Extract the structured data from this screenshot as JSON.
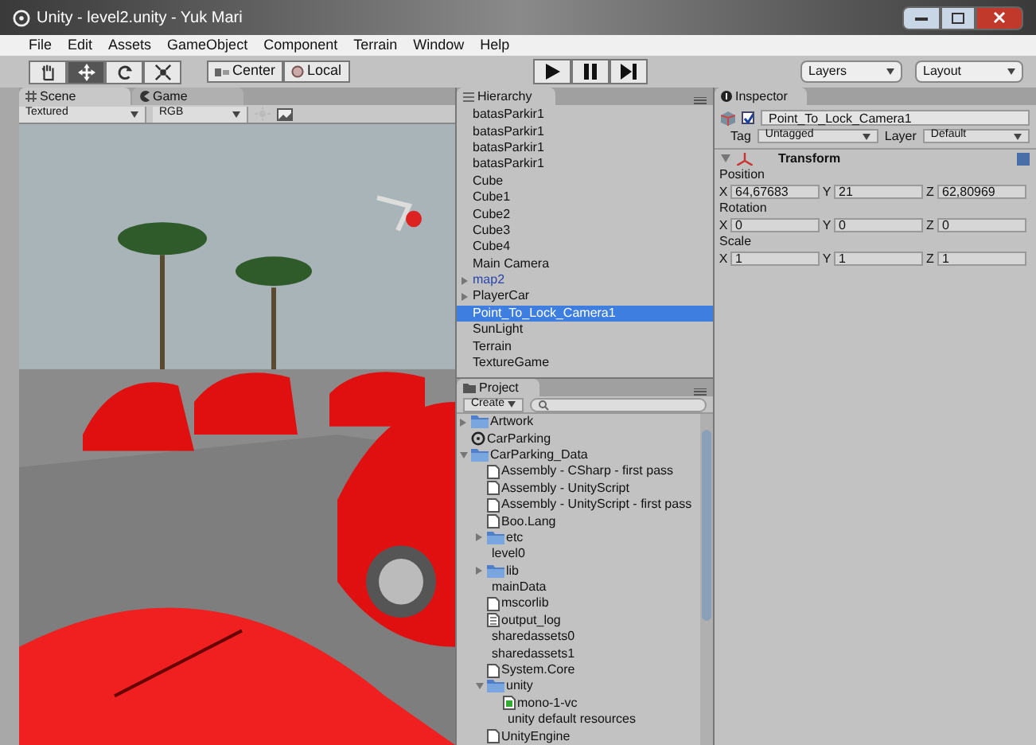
{
  "window": {
    "title": "Unity - level2.unity - Yuk Mari"
  },
  "menu": [
    "File",
    "Edit",
    "Assets",
    "GameObject",
    "Component",
    "Terrain",
    "Window",
    "Help"
  ],
  "toolbar": {
    "tools": [
      {
        "kind": "hand",
        "selected": false
      },
      {
        "kind": "move",
        "selected": true
      },
      {
        "kind": "rotate",
        "selected": false
      },
      {
        "kind": "scale",
        "selected": false
      }
    ],
    "pivot": [
      "Center",
      "Local"
    ],
    "play": [
      {
        "kind": "play"
      },
      {
        "kind": "pause"
      },
      {
        "kind": "step"
      }
    ],
    "layers": "Layers",
    "layout": "Layout"
  },
  "scene": {
    "tabs": [
      {
        "label": "Scene",
        "selected": true
      },
      {
        "label": "Game",
        "selected": false
      }
    ],
    "render_mode": "Textured",
    "color_mode": "RGB"
  },
  "hierarchy": {
    "title": "Hierarchy",
    "items": [
      {
        "label": "batasParkir1",
        "selected": false,
        "expandable": false,
        "prefab": false
      },
      {
        "label": "batasParkir1",
        "selected": false,
        "expandable": false,
        "prefab": false
      },
      {
        "label": "batasParkir1",
        "selected": false,
        "expandable": false,
        "prefab": false
      },
      {
        "label": "batasParkir1",
        "selected": false,
        "expandable": false,
        "prefab": false
      },
      {
        "label": "Cube",
        "selected": false,
        "expandable": false,
        "prefab": false
      },
      {
        "label": "Cube1",
        "selected": false,
        "expandable": false,
        "prefab": false
      },
      {
        "label": "Cube2",
        "selected": false,
        "expandable": false,
        "prefab": false
      },
      {
        "label": "Cube3",
        "selected": false,
        "expandable": false,
        "prefab": false
      },
      {
        "label": "Cube4",
        "selected": false,
        "expandable": false,
        "prefab": false
      },
      {
        "label": "Main Camera",
        "selected": false,
        "expandable": false,
        "prefab": false
      },
      {
        "label": "map2",
        "selected": false,
        "expandable": true,
        "prefab": true
      },
      {
        "label": "PlayerCar",
        "selected": false,
        "expandable": true,
        "prefab": false
      },
      {
        "label": "Point_To_Lock_Camera1",
        "selected": true,
        "expandable": false,
        "prefab": false
      },
      {
        "label": "SunLight",
        "selected": false,
        "expandable": false,
        "prefab": false
      },
      {
        "label": "Terrain",
        "selected": false,
        "expandable": false,
        "prefab": false
      },
      {
        "label": "TextureGame",
        "selected": false,
        "expandable": false,
        "prefab": false
      }
    ]
  },
  "project": {
    "title": "Project",
    "create": "Create",
    "items": [
      {
        "label": "Artwork",
        "kind": "folder",
        "expanded": false
      },
      {
        "label": "CarParking",
        "kind": "unity"
      },
      {
        "label": "CarParking_Data",
        "kind": "folder",
        "expanded": true,
        "children": [
          {
            "label": "Assembly - CSharp - first pass",
            "kind": "file"
          },
          {
            "label": "Assembly - UnityScript",
            "kind": "file"
          },
          {
            "label": "Assembly - UnityScript - first pass",
            "kind": "file"
          },
          {
            "label": "Boo.Lang",
            "kind": "file"
          },
          {
            "label": "etc",
            "kind": "folder",
            "expanded": false
          },
          {
            "label": "level0",
            "kind": "plain"
          },
          {
            "label": "lib",
            "kind": "folder",
            "expanded": false
          },
          {
            "label": "mainData",
            "kind": "plain"
          },
          {
            "label": "mscorlib",
            "kind": "file"
          },
          {
            "label": "output_log",
            "kind": "text"
          },
          {
            "label": "sharedassets0",
            "kind": "plain"
          },
          {
            "label": "sharedassets1",
            "kind": "plain"
          },
          {
            "label": "System.Core",
            "kind": "file"
          },
          {
            "label": "unity",
            "kind": "folder",
            "expanded": true,
            "children": [
              {
                "label": "mono-1-vc",
                "kind": "script"
              },
              {
                "label": "unity default resources",
                "kind": "plain"
              }
            ]
          },
          {
            "label": "UnityEngine",
            "kind": "file"
          }
        ]
      }
    ]
  },
  "inspector": {
    "title": "Inspector",
    "active": true,
    "object_name": "Point_To_Lock_Camera1",
    "tag_label": "Tag",
    "tag": "Untagged",
    "layer_label": "Layer",
    "layer": "Default",
    "component": "Transform",
    "groups": [
      {
        "label": "Position",
        "fields": [
          {
            "axis": "X",
            "value": "64,67683"
          },
          {
            "axis": "Y",
            "value": "21"
          },
          {
            "axis": "Z",
            "value": "62,80969"
          }
        ]
      },
      {
        "label": "Rotation",
        "fields": [
          {
            "axis": "X",
            "value": "0"
          },
          {
            "axis": "Y",
            "value": "0"
          },
          {
            "axis": "Z",
            "value": "0"
          }
        ]
      },
      {
        "label": "Scale",
        "fields": [
          {
            "axis": "X",
            "value": "1"
          },
          {
            "axis": "Y",
            "value": "1"
          },
          {
            "axis": "Z",
            "value": "1"
          }
        ]
      }
    ]
  }
}
